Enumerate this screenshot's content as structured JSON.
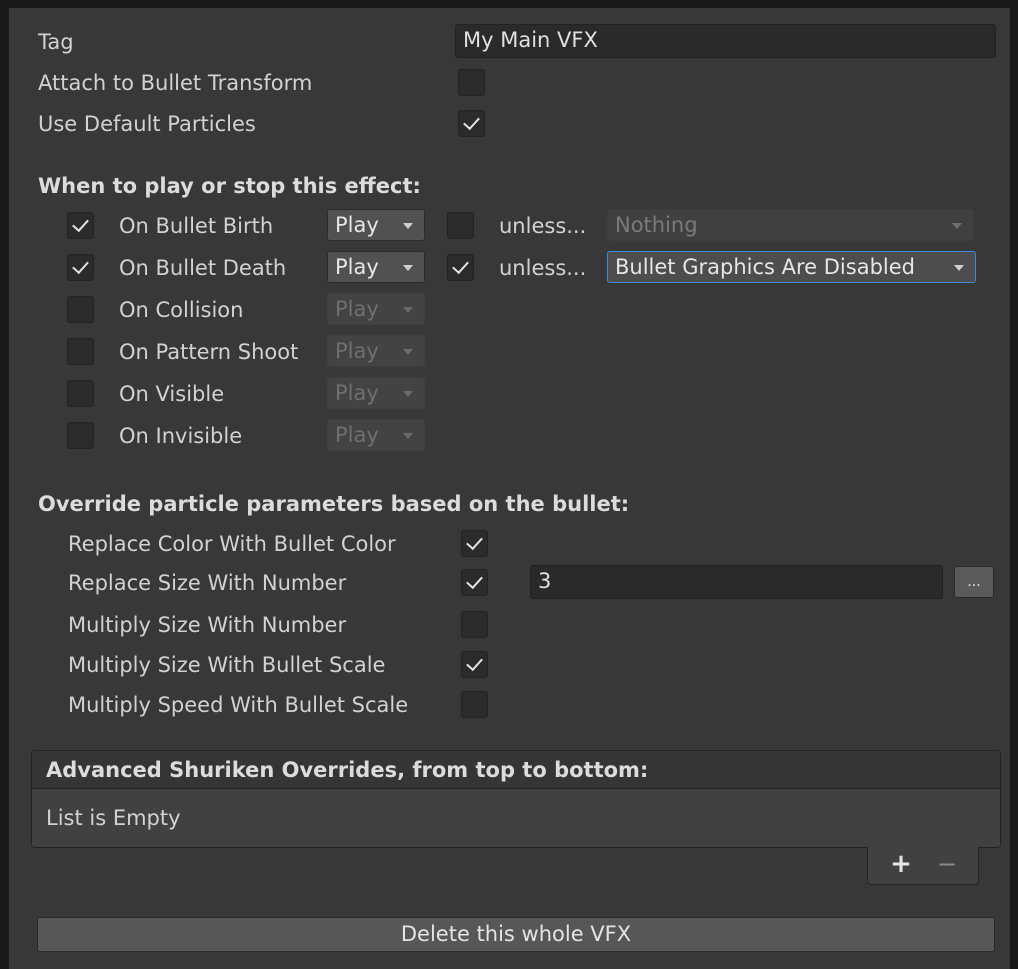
{
  "general": {
    "tag_label": "Tag",
    "tag_value": "My Main VFX",
    "attach_label": "Attach to Bullet Transform",
    "attach_checked": false,
    "default_particles_label": "Use Default Particles",
    "default_particles_checked": true
  },
  "play_section": {
    "heading": "When to play or stop this effect:",
    "rows": [
      {
        "enabled": true,
        "label": "On Bullet Birth",
        "action": "Play",
        "unless_checked": false,
        "unless_label": "unless...",
        "condition": "Nothing"
      },
      {
        "enabled": true,
        "label": "On Bullet Death",
        "action": "Play",
        "unless_checked": true,
        "unless_label": "unless...",
        "condition": "Bullet Graphics Are Disabled"
      },
      {
        "enabled": false,
        "label": "On Collision",
        "action": "Play"
      },
      {
        "enabled": false,
        "label": "On Pattern Shoot",
        "action": "Play"
      },
      {
        "enabled": false,
        "label": "On Visible",
        "action": "Play"
      },
      {
        "enabled": false,
        "label": "On Invisible",
        "action": "Play"
      }
    ]
  },
  "override_section": {
    "heading": "Override particle parameters based on the bullet:",
    "items": [
      {
        "label": "Replace Color With Bullet Color",
        "checked": true
      },
      {
        "label": "Replace Size With Number",
        "checked": true,
        "value": "3",
        "more_label": "..."
      },
      {
        "label": "Multiply Size With Number",
        "checked": false
      },
      {
        "label": "Multiply Size With Bullet Scale",
        "checked": true
      },
      {
        "label": "Multiply Speed With Bullet Scale",
        "checked": false
      }
    ]
  },
  "advanced": {
    "header": "Advanced Shuriken Overrides, from top to bottom:",
    "empty_text": "List is Empty",
    "add_label": "+",
    "remove_label": "−"
  },
  "footer": {
    "delete_label": "Delete this whole VFX"
  },
  "colors": {
    "panel_bg": "#383838",
    "field_bg": "#2a2a2a",
    "focus_outline": "#3c8cd9"
  }
}
